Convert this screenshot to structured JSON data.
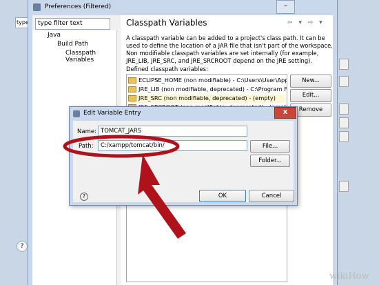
{
  "background_window": {
    "filter_placeholder": "type",
    "help_symbol": "?"
  },
  "preferences": {
    "title": "Preferences (Filtered)",
    "minimize_symbol": "–",
    "filter_placeholder": "type filter text",
    "tree": [
      {
        "label": "Java",
        "level": 0
      },
      {
        "label": "Build Path",
        "level": 1
      },
      {
        "label": "Classpath Variables",
        "level": 2
      }
    ],
    "page_title": "Classpath Variables",
    "nav_arrows": "⇦ ▾ ⇨ ▾",
    "description": "A classpath variable can be added to a project's class path. It can be used to define the location of a JAR file that isn't part of the workspace. Non modifiable classpath variables are set internally (for example, JRE_LIB, JRE_SRC, and JRE_SRCROOT depend on the JRE setting).",
    "defined_label": "Defined classpath variables:",
    "variables": [
      "ECLIPSE_HOME (non modifiable) - C:\\Users\\User\\AppData\\",
      "JRE_LIB (non modifiable, deprecated) - C:\\Program Files\\Ja",
      "JRE_SRC (non modifiable, deprecated) - (empty)",
      "JRE_SRCROOT (non modifiable, deprecated) - (empty)"
    ],
    "buttons": {
      "new": "New...",
      "edit": "Edit...",
      "remove": "Remove"
    }
  },
  "dialog": {
    "title": "Edit Variable Entry",
    "close_symbol": "x",
    "name_label": "Name:",
    "name_value": "TOMCAT_JARS",
    "path_label": "Path:",
    "path_value": "C:/xampp/tomcat/bin/",
    "file_button": "File...",
    "folder_button": "Folder...",
    "ok_button": "OK",
    "cancel_button": "Cancel",
    "help_symbol": "?"
  },
  "annotation": {
    "color": "#b0121b"
  },
  "watermark": "wikiHow"
}
